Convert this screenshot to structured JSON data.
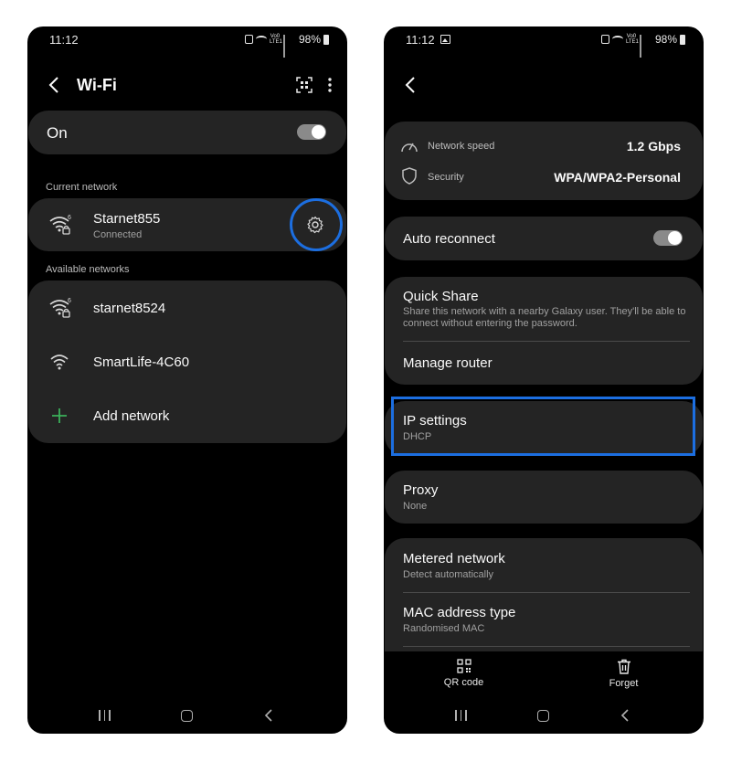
{
  "left": {
    "status": {
      "time": "11:12",
      "battery": "98%"
    },
    "title": "Wi-Fi",
    "toggle_label": "On",
    "current_label": "Current network",
    "current_network": {
      "name": "Starnet855",
      "status": "Connected"
    },
    "available_label": "Available networks",
    "available": [
      {
        "name": "starnet8524"
      },
      {
        "name": "SmartLife-4C60"
      }
    ],
    "add_network": "Add network"
  },
  "right": {
    "status": {
      "time": "11:12",
      "battery": "98%"
    },
    "info": {
      "speed_label": "Network speed",
      "speed_value": "1.2 Gbps",
      "security_label": "Security",
      "security_value": "WPA/WPA2-Personal"
    },
    "auto_reconnect": "Auto reconnect",
    "quick_share": {
      "title": "Quick Share",
      "desc": "Share this network with a nearby Galaxy user. They'll be able to connect without entering the password."
    },
    "manage_router": "Manage router",
    "ip_settings": {
      "title": "IP settings",
      "value": "DHCP"
    },
    "proxy": {
      "title": "Proxy",
      "value": "None"
    },
    "metered": {
      "title": "Metered network",
      "value": "Detect automatically"
    },
    "mac": {
      "title": "MAC address type",
      "value": "Randomised MAC"
    },
    "actions": {
      "qr": "QR code",
      "forget": "Forget"
    }
  },
  "colors": {
    "highlight": "#1c6ee0",
    "card": "#242424",
    "add_icon": "#3bb05a"
  }
}
